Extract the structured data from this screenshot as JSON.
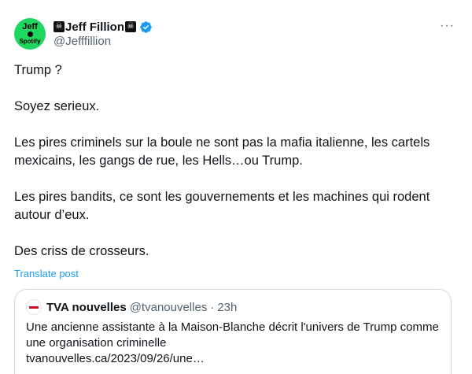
{
  "author": {
    "display_name": "Jeff Fillion",
    "handle": "@Jefffillion",
    "flag_glyph": "☠",
    "avatar_top": "Jeff",
    "avatar_bottom": "Spotify",
    "verified_color": "#1d9bf0"
  },
  "tweet": {
    "paragraphs": [
      "Trump ?",
      "Soyez serieux.",
      "Les pires criminels sur la boule ne sont pas la mafia italienne, les cartels mexicains, les gangs de rue, les Hells…ou Trump.",
      "Les pires bandits, ce sont les gouvernements et les machines qui rodent autour d’eux.",
      "Des criss de crosseurs."
    ],
    "translate_label": "Translate post"
  },
  "menu": {
    "more_label": "···"
  },
  "quote": {
    "name": "TVA nouvelles",
    "handle": "@tvanouvelles",
    "separator": "·",
    "time": "23h",
    "line1": "Une ancienne assistante à la Maison-Blanche décrit l'univers de Trump comme",
    "line2": "une organisation criminelle",
    "line3": "tvanouvelles.ca/2023/09/26/une…"
  },
  "colors": {
    "accent": "#1d9bf0",
    "muted": "#536471",
    "text": "#0f1419",
    "border": "#cfd9de"
  }
}
